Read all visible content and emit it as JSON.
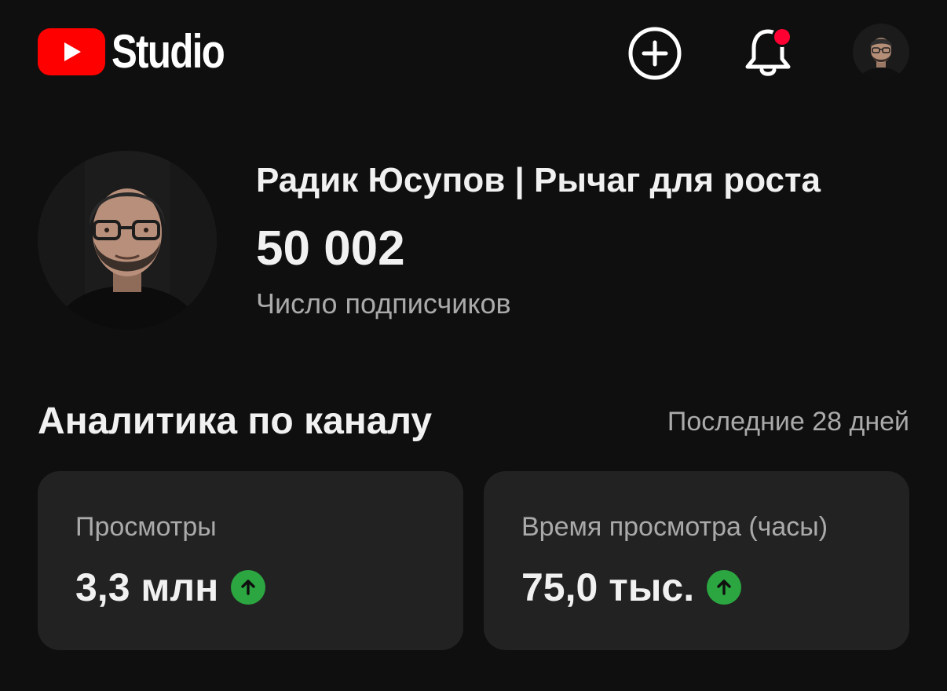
{
  "header": {
    "logo_text": "Studio",
    "icons": {
      "logo": "youtube-play-icon",
      "create": "plus-circle-icon",
      "notifications": "bell-icon",
      "account": "account-avatar"
    },
    "notification_dot_color": "#ff0033"
  },
  "channel": {
    "name": "Радик Юсупов | Рычаг для роста",
    "subscribers": "50 002",
    "subscribers_label": "Число подписчиков"
  },
  "analytics": {
    "title": "Аналитика по каналу",
    "range": "Последние 28 дней",
    "cards": [
      {
        "label": "Просмотры",
        "value": "3,3 млн",
        "trend": "up"
      },
      {
        "label": "Время просмотра (часы)",
        "value": "75,0 тыс.",
        "trend": "up"
      }
    ]
  },
  "colors": {
    "background": "#0f0f0f",
    "card": "#222222",
    "brand_red": "#ff0000",
    "trend_up": "#2ba640",
    "secondary_text": "#aaaaaa"
  }
}
